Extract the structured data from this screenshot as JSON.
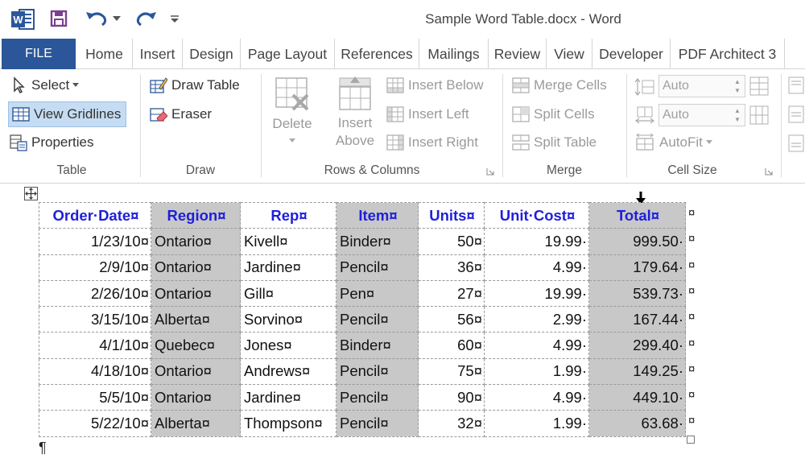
{
  "app": {
    "title": "Sample Word Table.docx - Word",
    "logo_letter": "W"
  },
  "qat": {
    "save": "save-icon",
    "undo": "undo-icon",
    "redo": "redo-icon",
    "customize": "customize-qat-icon"
  },
  "tabs": {
    "file": "FILE",
    "items": [
      "Home",
      "Insert",
      "Design",
      "Page Layout",
      "References",
      "Mailings",
      "Review",
      "View",
      "Developer",
      "PDF Architect 3"
    ]
  },
  "ribbon": {
    "table": {
      "label": "Table",
      "select": "Select",
      "view_gridlines": "View Gridlines",
      "properties": "Properties"
    },
    "draw": {
      "label": "Draw",
      "draw_table": "Draw Table",
      "eraser": "Eraser"
    },
    "rows_columns": {
      "label": "Rows & Columns",
      "delete": "Delete",
      "insert_above_1": "Insert",
      "insert_above_2": "Above",
      "insert_below": "Insert Below",
      "insert_left": "Insert Left",
      "insert_right": "Insert Right"
    },
    "merge": {
      "label": "Merge",
      "merge_cells": "Merge Cells",
      "split_cells": "Split Cells",
      "split_table": "Split Table"
    },
    "cell_size": {
      "label": "Cell Size",
      "height_value": "Auto",
      "width_value": "Auto",
      "autofit": "AutoFit"
    }
  },
  "document": {
    "headers": [
      "Order·Date¤",
      "Region¤",
      "Rep¤",
      "Item¤",
      "Units¤",
      "Unit·Cost¤",
      "Total¤"
    ],
    "rows": [
      [
        "1/23/10¤",
        "Ontario¤",
        "Kivell¤",
        "Binder¤",
        "50¤",
        "19.99·",
        "999.50·"
      ],
      [
        "2/9/10¤",
        "Ontario¤",
        "Jardine¤",
        "Pencil¤",
        "36¤",
        "4.99·",
        "179.64·"
      ],
      [
        "2/26/10¤",
        "Ontario¤",
        "Gill¤",
        "Pen¤",
        "27¤",
        "19.99·",
        "539.73·"
      ],
      [
        "3/15/10¤",
        "Alberta¤",
        "Sorvino¤",
        "Pencil¤",
        "56¤",
        "2.99·",
        "167.44·"
      ],
      [
        "4/1/10¤",
        "Quebec¤",
        "Jones¤",
        "Binder¤",
        "60¤",
        "4.99·",
        "299.40·"
      ],
      [
        "4/18/10¤",
        "Ontario¤",
        "Andrews¤",
        "Pencil¤",
        "75¤",
        "1.99·",
        "149.25·"
      ],
      [
        "5/5/10¤",
        "Ontario¤",
        "Jardine¤",
        "Pencil¤",
        "90¤",
        "4.99·",
        "449.10·"
      ],
      [
        "5/22/10¤",
        "Alberta¤",
        "Thompson¤",
        "Pencil¤",
        "32¤",
        "1.99·",
        "63.68·"
      ]
    ],
    "row_end_mark": "¤",
    "paragraph_mark": "¶"
  },
  "colors": {
    "file_tab": "#2b579a",
    "header_text": "#1f1fdc",
    "selected_cell": "#c8c8c8",
    "title_icon": "#2b579a",
    "save_icon": "#7b3f8f"
  }
}
